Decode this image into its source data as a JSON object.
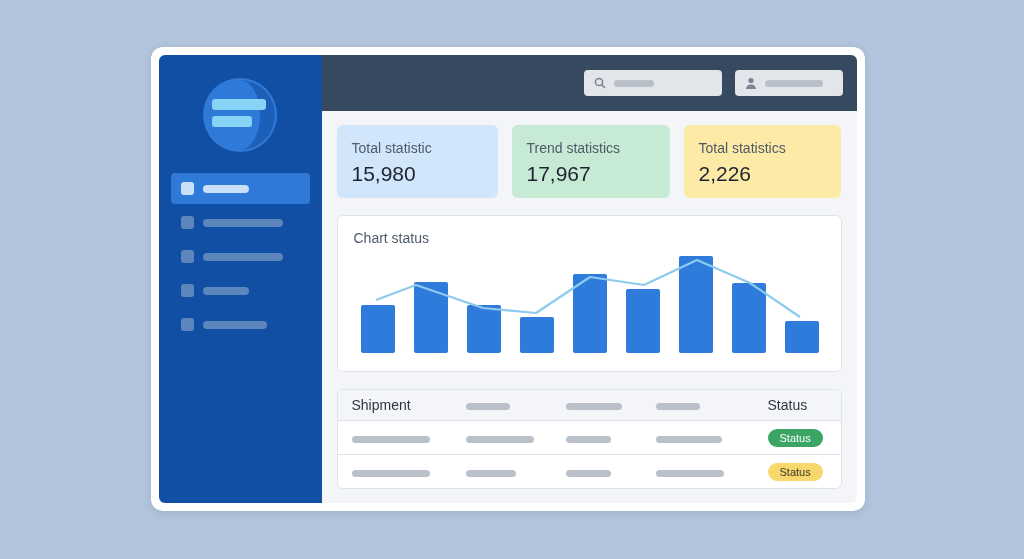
{
  "sidebar": {
    "items": [
      {
        "selected": true
      },
      {
        "selected": false
      },
      {
        "selected": false
      },
      {
        "selected": false
      },
      {
        "selected": false
      }
    ]
  },
  "stats": [
    {
      "label": "Total statistic",
      "value": "15,980",
      "color": "#d2e6fb"
    },
    {
      "label": "Trend statistics",
      "value": "17,967",
      "color": "#c7ead4"
    },
    {
      "label": "Total statistics",
      "value": "2,226",
      "color": "#fdeaa6"
    }
  ],
  "chart": {
    "title": "Chart status"
  },
  "table": {
    "columns": [
      "Shipment",
      "Status"
    ],
    "rows": [
      {
        "status": "Status",
        "color": "#3aa565"
      },
      {
        "status": "Status",
        "color": "#f8d76c"
      }
    ]
  }
}
